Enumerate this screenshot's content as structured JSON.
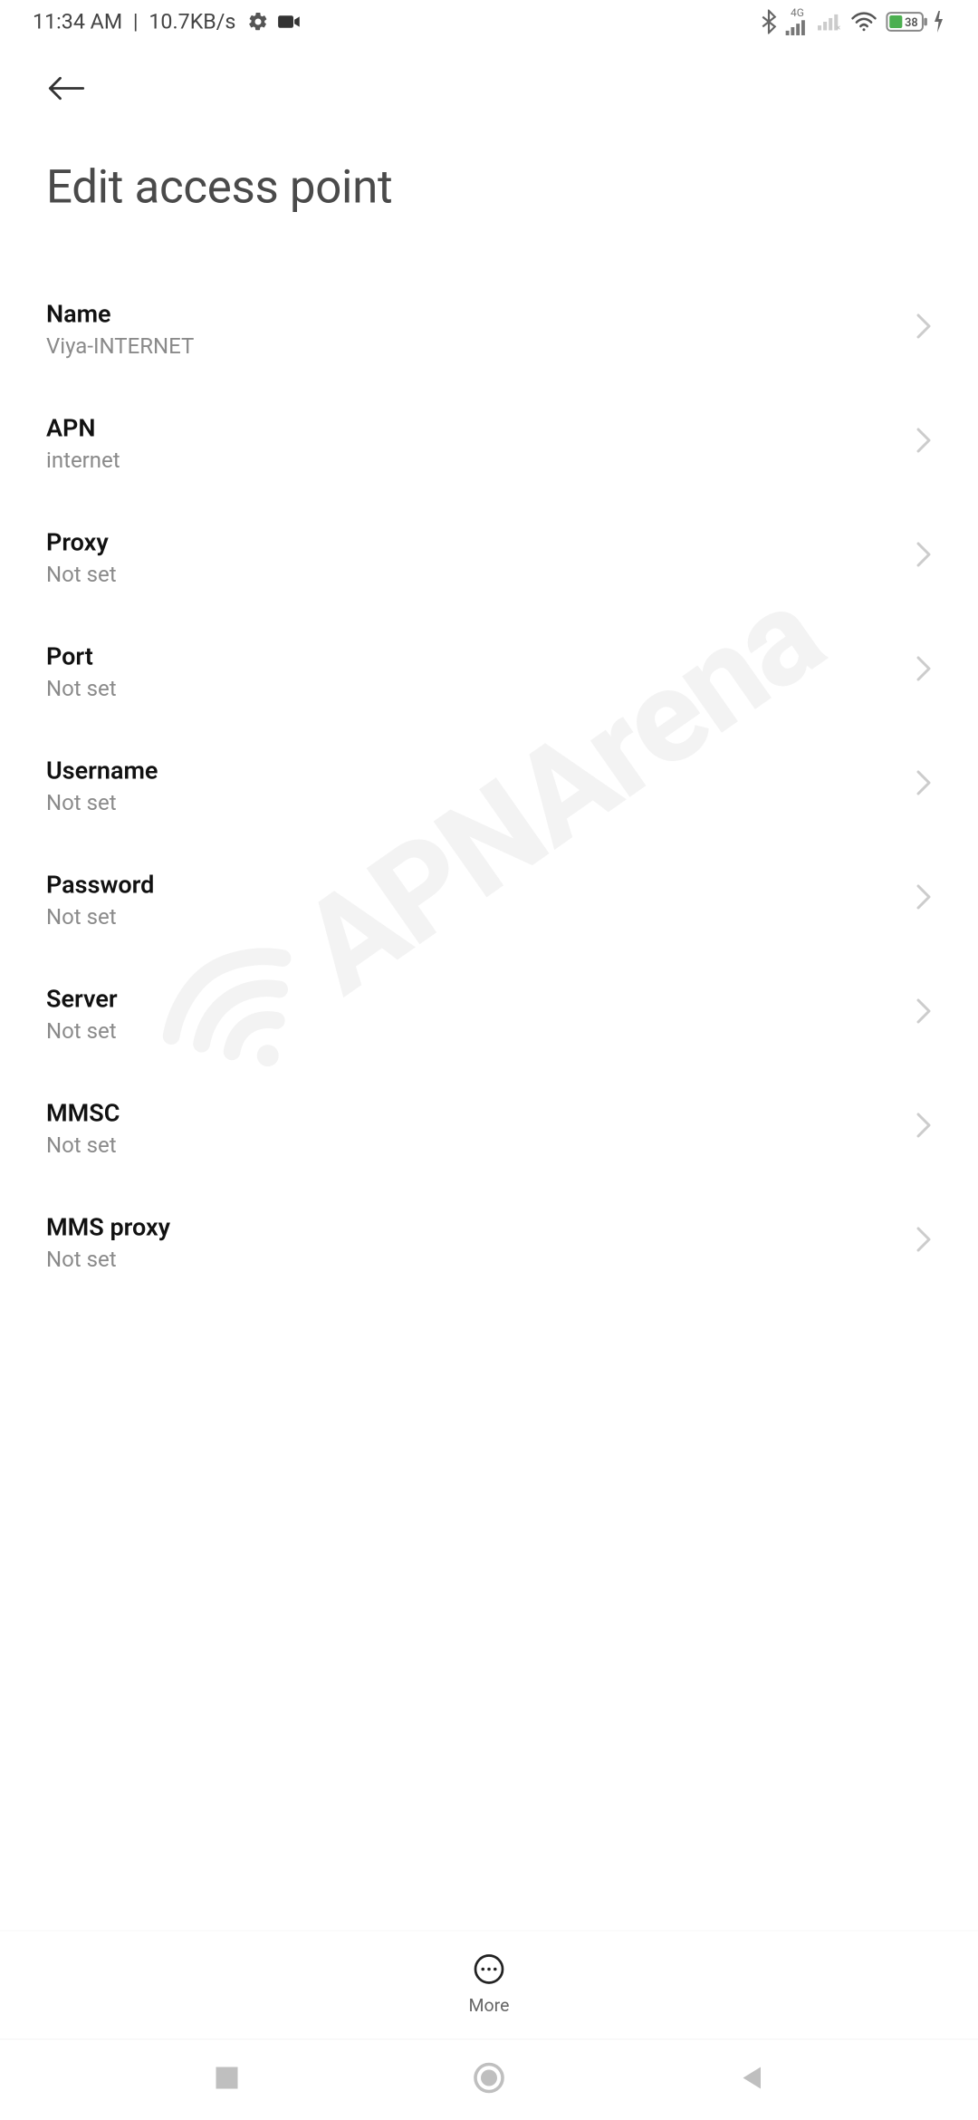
{
  "status": {
    "time": "11:34 AM",
    "speed": "10.7KB/s",
    "network_label": "4G",
    "battery_pct": "38"
  },
  "header": {
    "title": "Edit access point"
  },
  "rows": [
    {
      "label": "Name",
      "value": "Viya-INTERNET"
    },
    {
      "label": "APN",
      "value": "internet"
    },
    {
      "label": "Proxy",
      "value": "Not set"
    },
    {
      "label": "Port",
      "value": "Not set"
    },
    {
      "label": "Username",
      "value": "Not set"
    },
    {
      "label": "Password",
      "value": "Not set"
    },
    {
      "label": "Server",
      "value": "Not set"
    },
    {
      "label": "MMSC",
      "value": "Not set"
    },
    {
      "label": "MMS proxy",
      "value": "Not set"
    }
  ],
  "bottom": {
    "more_label": "More"
  },
  "watermark": {
    "text": "APNArena"
  }
}
